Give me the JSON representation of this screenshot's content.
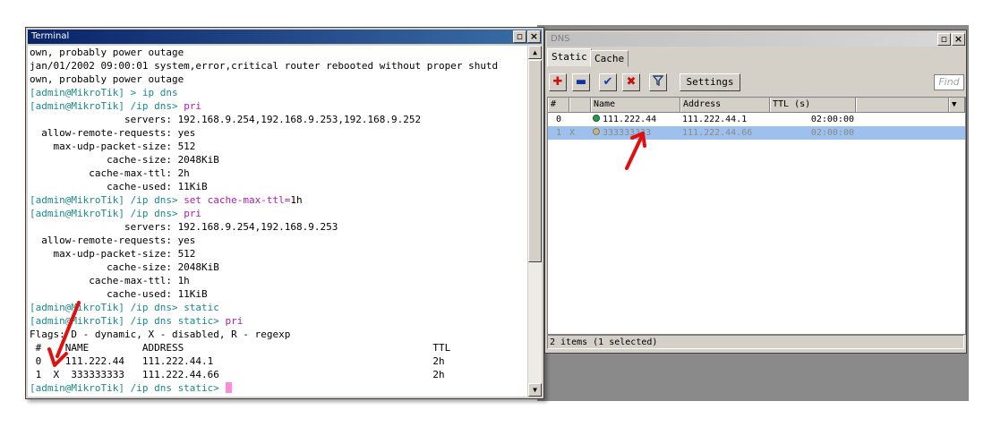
{
  "terminal": {
    "title": "Terminal",
    "lines": [
      {
        "parts": [
          {
            "t": "own, probably power outage",
            "c": ""
          }
        ]
      },
      {
        "parts": [
          {
            "t": "jan/01/2002 09:00:01 system,error,critical router rebooted without proper shutd",
            "c": ""
          }
        ]
      },
      {
        "parts": [
          {
            "t": "own, probably power outage",
            "c": ""
          }
        ]
      },
      {
        "parts": [
          {
            "t": "[admin@MikroTik] > ",
            "c": "teal"
          },
          {
            "t": "ip dns",
            "c": "teal"
          }
        ]
      },
      {
        "parts": [
          {
            "t": "[admin@MikroTik] /ip dns> ",
            "c": "teal"
          },
          {
            "t": "pri",
            "c": "mag"
          }
        ]
      },
      {
        "parts": [
          {
            "t": "                servers: 192.168.9.254,192.168.9.253,192.168.9.252",
            "c": ""
          }
        ]
      },
      {
        "parts": [
          {
            "t": "  allow-remote-requests: yes",
            "c": ""
          }
        ]
      },
      {
        "parts": [
          {
            "t": "    max-udp-packet-size: 512",
            "c": ""
          }
        ]
      },
      {
        "parts": [
          {
            "t": "             cache-size: 2048KiB",
            "c": ""
          }
        ]
      },
      {
        "parts": [
          {
            "t": "          cache-max-ttl: 2h",
            "c": ""
          }
        ]
      },
      {
        "parts": [
          {
            "t": "             cache-used: 11KiB",
            "c": ""
          }
        ]
      },
      {
        "parts": [
          {
            "t": "[admin@MikroTik] /ip dns> ",
            "c": "teal"
          },
          {
            "t": "set cache-max-ttl=",
            "c": "mag"
          },
          {
            "t": "1h",
            "c": ""
          }
        ]
      },
      {
        "parts": [
          {
            "t": "[admin@MikroTik] /ip dns> ",
            "c": "teal"
          },
          {
            "t": "pri",
            "c": "mag"
          }
        ]
      },
      {
        "parts": [
          {
            "t": "                servers: 192.168.9.254,192.168.9.253",
            "c": ""
          }
        ]
      },
      {
        "parts": [
          {
            "t": "  allow-remote-requests: yes",
            "c": ""
          }
        ]
      },
      {
        "parts": [
          {
            "t": "    max-udp-packet-size: 512",
            "c": ""
          }
        ]
      },
      {
        "parts": [
          {
            "t": "             cache-size: 2048KiB",
            "c": ""
          }
        ]
      },
      {
        "parts": [
          {
            "t": "          cache-max-ttl: 1h",
            "c": ""
          }
        ]
      },
      {
        "parts": [
          {
            "t": "             cache-used: 11KiB",
            "c": ""
          }
        ]
      },
      {
        "parts": [
          {
            "t": "[admin@MikroTik] /ip dns> ",
            "c": "teal"
          },
          {
            "t": "static",
            "c": "teal"
          }
        ]
      },
      {
        "parts": [
          {
            "t": "[admin@MikroTik] /ip dns static> ",
            "c": "teal"
          },
          {
            "t": "pri",
            "c": "mag"
          }
        ]
      },
      {
        "parts": [
          {
            "t": "Flags: D - dynamic, X - disabled, R - regexp",
            "c": ""
          }
        ]
      },
      {
        "parts": [
          {
            "t": " #    NAME         ADDRESS                                          TTL",
            "c": ""
          }
        ]
      },
      {
        "parts": [
          {
            "t": " 0    111.222.44   111.222.44.1                                     2h",
            "c": ""
          }
        ]
      },
      {
        "parts": [
          {
            "t": " 1  X  333333333   111.222.44.66                                    2h",
            "c": ""
          }
        ]
      },
      {
        "parts": [
          {
            "t": "[admin@MikroTik] /ip dns static> ",
            "c": "teal"
          }
        ],
        "cursor": true
      }
    ]
  },
  "dns": {
    "title": "DNS",
    "tabs": [
      "Static",
      "Cache"
    ],
    "settings_label": "Settings",
    "find_placeholder": "Find",
    "columns": [
      "#",
      "",
      "Name",
      "Address",
      "TTL (s)"
    ],
    "rows": [
      {
        "num": "0",
        "flag": "",
        "name": "111.222.44",
        "address": "111.222.44.1",
        "ttl": "02:00:00",
        "selected": false,
        "disabled": false
      },
      {
        "num": "1",
        "flag": "X",
        "name": "333333333",
        "address": "111.222.44.66",
        "ttl": "02:00:00",
        "selected": true,
        "disabled": true
      }
    ],
    "status": "2 items (1 selected)"
  },
  "colors": {
    "prompt": "#1a8a8a",
    "command": "#b01ab0",
    "selection": "#9ec0ec",
    "arrow": "#e01010"
  }
}
